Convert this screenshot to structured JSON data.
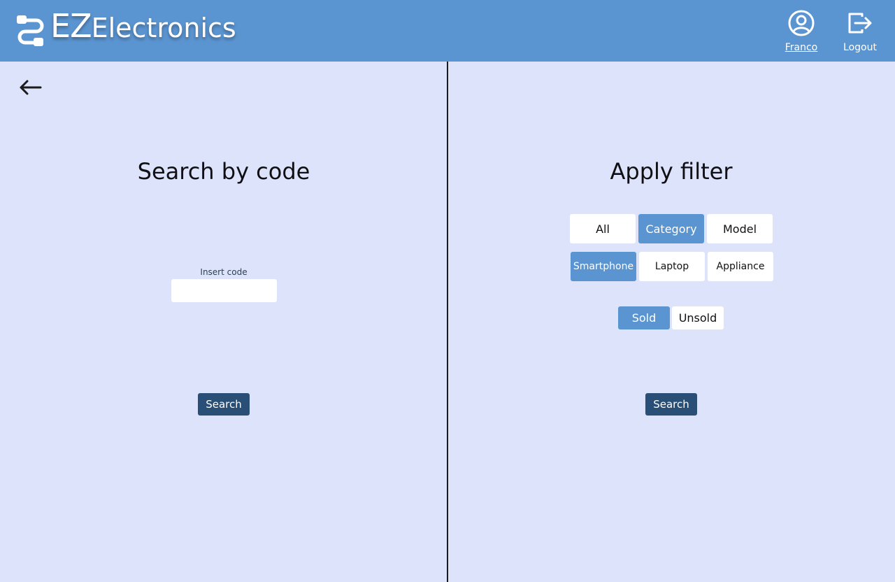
{
  "header": {
    "brand_prefix": "EZ",
    "brand_suffix": "Electronics",
    "user_label": "Franco",
    "logout_label": "Logout"
  },
  "left_panel": {
    "title": "Search by code",
    "code_label": "Insert code",
    "code_value": "",
    "search_label": "Search"
  },
  "right_panel": {
    "title": "Apply filter",
    "filter_type": {
      "options": [
        "All",
        "Category",
        "Model"
      ],
      "selected": "Category"
    },
    "category": {
      "options": [
        "Smartphone",
        "Laptop",
        "Appliance"
      ],
      "selected": "Smartphone"
    },
    "status": {
      "options": [
        "Sold",
        "Unsold"
      ],
      "selected": "Sold"
    },
    "search_label": "Search"
  },
  "icons": {
    "logo": "cable-logo-icon",
    "user": "user-circle-icon",
    "logout": "logout-icon",
    "back": "arrow-left-icon"
  },
  "colors": {
    "header_bg": "#5b95d1",
    "page_bg": "#dde3fa",
    "active_option": "#5b95d1",
    "search_button": "#2a4f76"
  }
}
